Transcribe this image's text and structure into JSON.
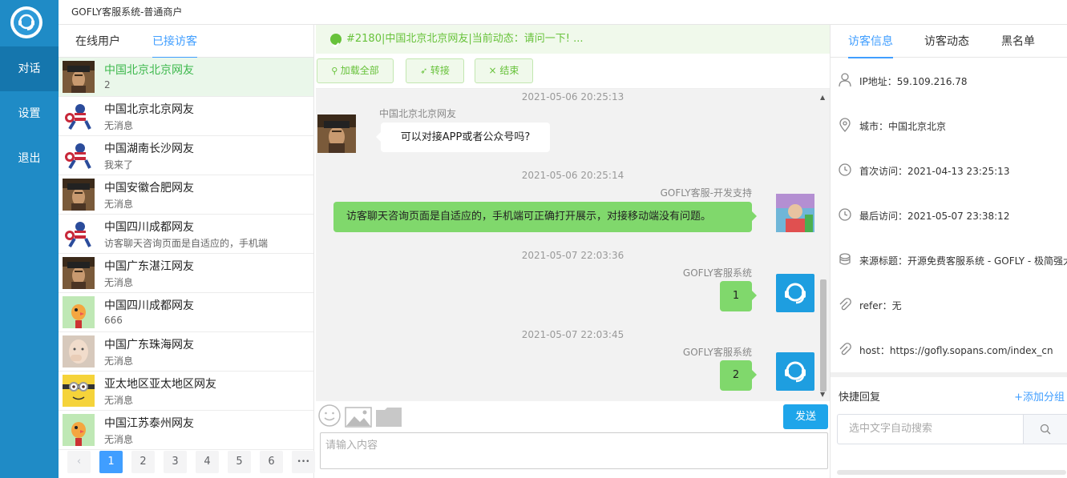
{
  "app_title": "GOFLY客服系统-普通商户",
  "nav": {
    "chat": "对话",
    "settings": "设置",
    "logout": "退出"
  },
  "left_tabs": [
    "在线用户",
    "已接访客"
  ],
  "visitors": [
    {
      "name": "中国北京北京网友",
      "msg": "2",
      "avatar": "pirate"
    },
    {
      "name": "中国北京北京网友",
      "msg": "无消息",
      "avatar": "captain"
    },
    {
      "name": "中国湖南长沙网友",
      "msg": "我来了",
      "avatar": "captain"
    },
    {
      "name": "中国安徽合肥网友",
      "msg": "无消息",
      "avatar": "pirate"
    },
    {
      "name": "中国四川成都网友",
      "msg": "访客聊天咨询页面是自适应的，手机端",
      "avatar": "captain"
    },
    {
      "name": "中国广东湛江网友",
      "msg": "无消息",
      "avatar": "pirate"
    },
    {
      "name": "中国四川成都网友",
      "msg": "666",
      "avatar": "bird"
    },
    {
      "name": "中国广东珠海网友",
      "msg": "无消息",
      "avatar": "baby"
    },
    {
      "name": "亚太地区亚太地区网友",
      "msg": "无消息",
      "avatar": "minion"
    },
    {
      "name": "中国江苏泰州网友",
      "msg": "无消息",
      "avatar": "bird"
    }
  ],
  "pagination": {
    "pages": [
      "1",
      "2",
      "3",
      "4",
      "5",
      "6"
    ],
    "current": "1",
    "prev": "‹",
    "more": "•••"
  },
  "chat_header": "#2180|中国北京北京网友|当前动态：请问一下! ...",
  "chat_buttons": {
    "load_all": "加载全部",
    "transfer": "转接",
    "end": "结束"
  },
  "messages": [
    {
      "time": "2021-05-06 20:25:13",
      "sender": "中国北京北京网友",
      "text": "可以对接APP或者公众号吗?"
    },
    {
      "time": "2021-05-06 20:25:14",
      "sender": "GOFLY客服-开发支持",
      "text": "访客聊天咨询页面是自适应的，手机端可正确打开展示，对接移动端没有问题。"
    },
    {
      "time": "2021-05-07 22:03:36",
      "sender": "GOFLY客服系统",
      "text": "1"
    },
    {
      "time": "2021-05-07 22:03:45",
      "sender": "GOFLY客服系统",
      "text": "2"
    }
  ],
  "send_label": "发送",
  "input_placeholder": "请输入内容",
  "right_tabs": [
    "访客信息",
    "访客动态",
    "黑名单"
  ],
  "info": {
    "ip": "IP地址：59.109.216.78",
    "city": "城市：中国北京北京",
    "first_visit": "首次访问：2021-04-13 23:25:13",
    "last_visit": "最后访问：2021-05-07 23:38:12",
    "source": "来源标题：开源免费客服系统 - GOFLY - 极简强大",
    "refer": "refer：无",
    "host": "host：https://gofly.sopans.com/index_cn"
  },
  "quick_reply": {
    "title": "快捷回复",
    "add": "+添加分组",
    "search_placeholder": "选中文字自动搜索"
  },
  "colors": {
    "nav_bg": "#1f8bc6",
    "accent": "#409eff",
    "green": "#67c23a",
    "bubble_out": "#80d86c",
    "send": "#1ea5ea"
  }
}
